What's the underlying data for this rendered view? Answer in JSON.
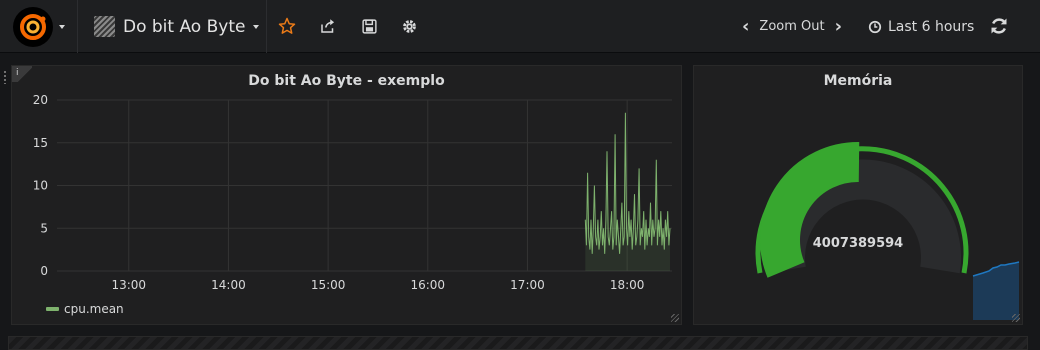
{
  "nav": {
    "dashboard_title": "Do bit Ao Byte",
    "zoom_out_label": "Zoom Out",
    "time_range_label": "Last 6 hours"
  },
  "panels": {
    "graph": {
      "title": "Do bit Ao Byte - exemplo",
      "info": "i",
      "legend": "cpu.mean"
    },
    "gauge": {
      "title": "Memória",
      "value": "4007389594"
    }
  },
  "colors": {
    "series": "#7eb26d",
    "gauge_fill": "#37a72f",
    "sparkline": "#1f78c1"
  },
  "chart_data": {
    "type": "line",
    "title": "Do bit Ao Byte - exemplo",
    "x_ticks": [
      "13:00",
      "14:00",
      "15:00",
      "16:00",
      "17:00",
      "18:00"
    ],
    "y_ticks": [
      "0",
      "5",
      "10",
      "15",
      "20"
    ],
    "ylim": [
      0,
      20
    ],
    "xlim_hours": [
      12.28,
      18.45
    ],
    "grid": true,
    "legend_placement": "bottom-left",
    "series": [
      {
        "name": "cpu.mean",
        "x_start_hour": 17.58,
        "x_end_hour": 18.43,
        "values": [
          6,
          3,
          11.5,
          4,
          2.5,
          6,
          2,
          5,
          10,
          4,
          3,
          6,
          2.5,
          4,
          7,
          3,
          5,
          2,
          6,
          14,
          4,
          3,
          5,
          7,
          2.5,
          4,
          16,
          3,
          6,
          4,
          2,
          5,
          8,
          3,
          4,
          18.5,
          5,
          3,
          7,
          4,
          6,
          2.5,
          5,
          9,
          3,
          4,
          6,
          12,
          3,
          5,
          4,
          7,
          2.5,
          6,
          3,
          5,
          4,
          8,
          3,
          6,
          4,
          5,
          13,
          3,
          6,
          4,
          7,
          3,
          5,
          2.5,
          6,
          4,
          7,
          3,
          5
        ]
      }
    ]
  }
}
